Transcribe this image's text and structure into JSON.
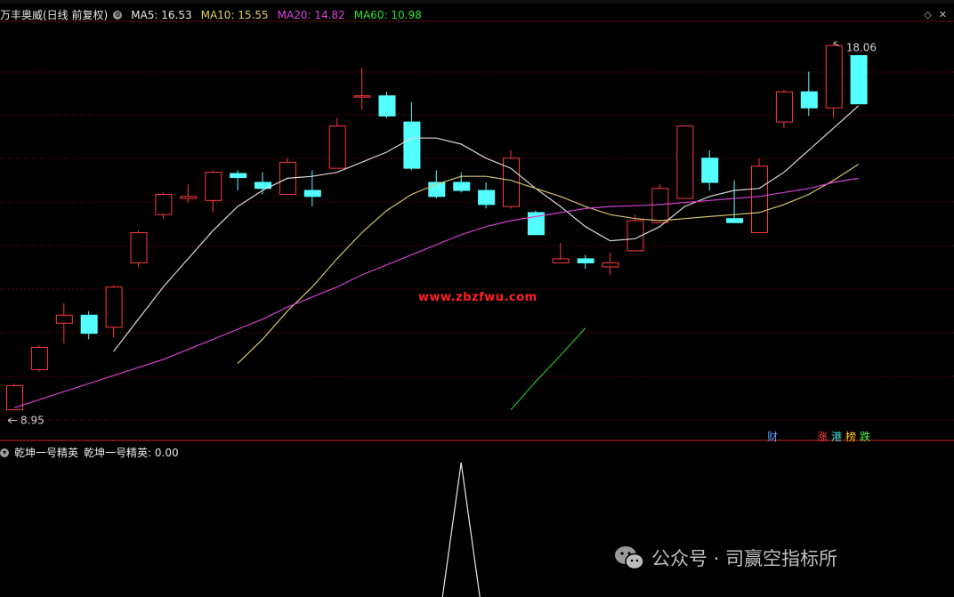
{
  "header": {
    "title": "万丰奥威(日线 前复权)",
    "ma5": "MA5: 16.53",
    "ma10": "MA10: 15.55",
    "ma20": "MA20: 14.82",
    "ma60": "MA60: 10.98"
  },
  "sub_header": {
    "name": "乾坤一号精英",
    "value": "乾坤一号精英: 0.00"
  },
  "watermark": "www.zbzfwu.com",
  "badges": {
    "cai": "财",
    "zhang": "涨",
    "gang": "港",
    "bang": "榜",
    "die": "跌"
  },
  "wechat": "公众号 · 司赢空指标所",
  "colors": {
    "up": "#ff3a3a",
    "down": "#54ffff",
    "ma5": "#d9d9d9",
    "ma10": "#d4c36a",
    "ma20": "#d040d0",
    "ma60": "#22c022",
    "grid": "#7a1515"
  },
  "chart_data": {
    "type": "candlestick",
    "price_range": [
      8.3,
      18.6
    ],
    "labels": {
      "high": "18.06",
      "low": "8.95"
    },
    "candles": [
      {
        "o": 8.95,
        "h": 9.6,
        "l": 8.95,
        "c": 9.55
      },
      {
        "o": 9.95,
        "h": 10.55,
        "l": 9.9,
        "c": 10.5
      },
      {
        "o": 11.1,
        "h": 11.6,
        "l": 10.6,
        "c": 11.3
      },
      {
        "o": 11.3,
        "h": 11.4,
        "l": 10.7,
        "c": 10.85
      },
      {
        "o": 11.0,
        "h": 12.05,
        "l": 10.75,
        "c": 12.0
      },
      {
        "o": 12.6,
        "h": 13.4,
        "l": 12.5,
        "c": 13.35
      },
      {
        "o": 13.8,
        "h": 14.35,
        "l": 13.7,
        "c": 14.3
      },
      {
        "o": 14.2,
        "h": 14.55,
        "l": 14.1,
        "c": 14.25
      },
      {
        "o": 14.15,
        "h": 14.9,
        "l": 13.85,
        "c": 14.85
      },
      {
        "o": 14.82,
        "h": 14.9,
        "l": 14.4,
        "c": 14.72
      },
      {
        "o": 14.6,
        "h": 14.85,
        "l": 14.3,
        "c": 14.45
      },
      {
        "o": 14.3,
        "h": 15.2,
        "l": 14.3,
        "c": 15.1
      },
      {
        "o": 14.4,
        "h": 14.9,
        "l": 14.0,
        "c": 14.25
      },
      {
        "o": 14.95,
        "h": 16.2,
        "l": 14.95,
        "c": 16.0
      },
      {
        "o": 16.75,
        "h": 17.45,
        "l": 16.4,
        "c": 16.75
      },
      {
        "o": 16.75,
        "h": 16.85,
        "l": 16.2,
        "c": 16.25
      },
      {
        "o": 16.1,
        "h": 16.6,
        "l": 14.9,
        "c": 14.95
      },
      {
        "o": 14.6,
        "h": 14.9,
        "l": 14.2,
        "c": 14.25
      },
      {
        "o": 14.6,
        "h": 14.85,
        "l": 14.35,
        "c": 14.4
      },
      {
        "o": 14.4,
        "h": 14.6,
        "l": 13.95,
        "c": 14.05
      },
      {
        "o": 14.0,
        "h": 15.4,
        "l": 13.95,
        "c": 15.2
      },
      {
        "o": 13.85,
        "h": 13.9,
        "l": 13.3,
        "c": 13.3
      },
      {
        "o": 12.6,
        "h": 13.1,
        "l": 12.6,
        "c": 12.7
      },
      {
        "o": 12.7,
        "h": 12.8,
        "l": 12.45,
        "c": 12.6
      },
      {
        "o": 12.5,
        "h": 12.85,
        "l": 12.3,
        "c": 12.6
      },
      {
        "o": 12.9,
        "h": 13.8,
        "l": 12.9,
        "c": 13.65
      },
      {
        "o": 13.6,
        "h": 14.55,
        "l": 13.6,
        "c": 14.45
      },
      {
        "o": 14.2,
        "h": 16.0,
        "l": 14.2,
        "c": 16.0
      },
      {
        "o": 15.2,
        "h": 15.4,
        "l": 14.4,
        "c": 14.6
      },
      {
        "o": 13.7,
        "h": 14.65,
        "l": 13.6,
        "c": 13.6
      },
      {
        "o": 13.35,
        "h": 15.2,
        "l": 13.35,
        "c": 15.0
      },
      {
        "o": 16.1,
        "h": 16.9,
        "l": 15.95,
        "c": 16.85
      },
      {
        "o": 16.85,
        "h": 17.35,
        "l": 16.25,
        "c": 16.45
      },
      {
        "o": 16.45,
        "h": 18.06,
        "l": 16.2,
        "c": 18.0
      },
      {
        "o": 17.75,
        "h": 17.75,
        "l": 16.55,
        "c": 16.55
      }
    ],
    "ma5": [
      null,
      null,
      null,
      null,
      10.4,
      11.2,
      12.0,
      12.7,
      13.4,
      14.0,
      14.4,
      14.7,
      14.75,
      14.85,
      15.1,
      15.35,
      15.7,
      15.7,
      15.55,
      15.2,
      14.95,
      14.45,
      14.0,
      13.5,
      13.15,
      13.2,
      13.5,
      14.0,
      14.25,
      14.4,
      14.45,
      14.85,
      15.4,
      15.95,
      16.5
    ],
    "ma10": [
      null,
      null,
      null,
      null,
      null,
      null,
      null,
      null,
      null,
      10.1,
      10.7,
      11.4,
      12.0,
      12.7,
      13.35,
      13.9,
      14.3,
      14.55,
      14.75,
      14.75,
      14.65,
      14.45,
      14.25,
      14.0,
      13.8,
      13.7,
      13.65,
      13.7,
      13.75,
      13.8,
      13.85,
      14.05,
      14.3,
      14.65,
      15.05
    ],
    "ma20": [
      9.0,
      9.2,
      9.4,
      9.6,
      9.8,
      10.0,
      10.2,
      10.45,
      10.7,
      10.95,
      11.2,
      11.5,
      11.75,
      12.0,
      12.3,
      12.55,
      12.8,
      13.05,
      13.3,
      13.5,
      13.65,
      13.75,
      13.85,
      13.95,
      14.0,
      14.02,
      14.05,
      14.1,
      14.15,
      14.2,
      14.25,
      14.35,
      14.45,
      14.6,
      14.7
    ],
    "ma60": {
      "start_index": 20,
      "values": [
        8.95,
        9.65,
        10.3,
        10.98
      ]
    },
    "indicator": {
      "spike_index": 18,
      "value": "0.00"
    }
  }
}
